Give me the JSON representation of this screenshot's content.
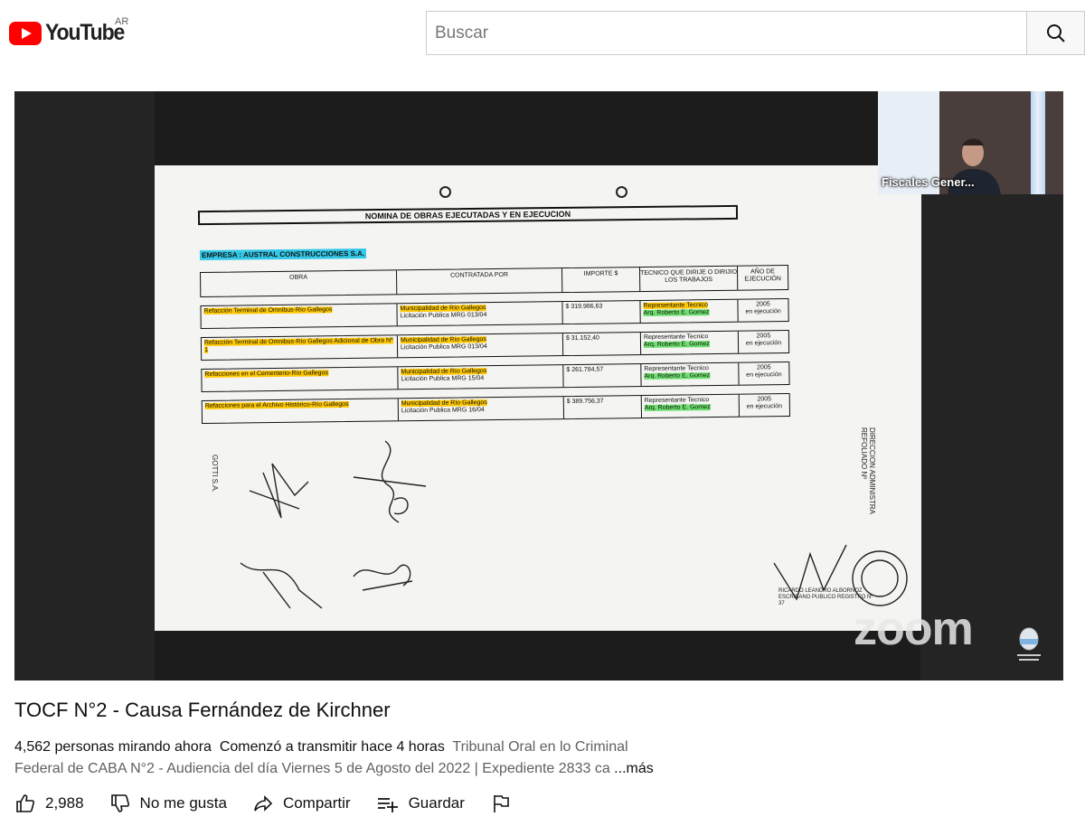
{
  "header": {
    "logo_text": "YouTube",
    "country_code": "AR",
    "search_placeholder": "Buscar"
  },
  "video": {
    "document": {
      "title": "NOMINA DE OBRAS EJECUTADAS Y EN EJECUCION",
      "company": "EMPRESA : AUSTRAL CONSTRUCCIONES S.A.",
      "columns": [
        "OBRA",
        "CONTRATADA POR",
        "IMPORTE $",
        "TECNICO QUE DIRIJE O DIRIJIO LOS TRABAJOS",
        "AÑO DE EJECUCIÓN"
      ],
      "rows": [
        {
          "obra": "Refacción Terminal de Omnibus-Río Gallegos",
          "contratada_1": "Municipalidad de Río Gallegos",
          "contratada_2": "Licitación Publica MRG 013/04",
          "importe": "$ 319.986,63",
          "tecnico_1": "Representante Tecnico",
          "tecnico_2": "Arq. Roberto E. Gomez",
          "anio_1": "2005",
          "anio_2": "en ejecución"
        },
        {
          "obra": "Refacción Terminal de Omnibus-Río Gallegos Adicional de Obra Nº 1",
          "contratada_1": "Municipalidad de Río Gallegos",
          "contratada_2": "Licitación Publica MRG 013/04",
          "importe": "$ 31.152,40",
          "tecnico_1": "Representante Tecnico",
          "tecnico_2": "Arq. Roberto E. Gomez",
          "anio_1": "2005",
          "anio_2": "en ejecución"
        },
        {
          "obra": "Refacciones en el Cementerio-Río Gallegos",
          "contratada_1": "Municipalidad de Río Gallegos",
          "contratada_2": "Licitación Publica MRG 15/04",
          "importe": "$ 261.784,57",
          "tecnico_1": "Representante Tecnico",
          "tecnico_2": "Arq. Roberto E. Gomez",
          "anio_1": "2005",
          "anio_2": "en ejecución"
        },
        {
          "obra": "Refacciones para el Archivo Histórico-Río Gallegos",
          "contratada_1": "Municipalidad de Río Gallegos",
          "contratada_2": "Licitación Publica MRG 16/04",
          "importe": "$ 389.756,37",
          "tecnico_1": "Representante Tecnico",
          "tecnico_2": "Arq. Roberto E. Gomez",
          "anio_1": "2005",
          "anio_2": "en ejecución"
        }
      ],
      "side_stamp": "DIRECCION ADMINISTRA REFOLIADO Nº",
      "notary": "RICARDO LEANDRO ALBORNOZ ESCRIBANO PUBLICO REGISTRO Nº 37"
    },
    "watermark": "zoom",
    "pip_label": "Fiscales Gener..."
  },
  "info": {
    "title": "TOCF N°2 - Causa Fernández de Kirchner",
    "viewers": "4,562 personas mirando ahora",
    "started": "Comenzó a transmitir hace 4 horas",
    "description_1": "Tribunal Oral en lo Criminal",
    "description_2": "Federal de CABA N°2 - Audiencia del día Viernes 5 de Agosto del 2022 | Expediente 2833 ca",
    "more": "...más"
  },
  "actions": {
    "like_count": "2,988",
    "dislike_label": "No me gusta",
    "share_label": "Compartir",
    "save_label": "Guardar"
  },
  "colors": {
    "brand_red": "#ff0000",
    "highlight_yellow": "#ffc800",
    "highlight_green": "#6fe06f",
    "highlight_cyan": "#33c8e8"
  }
}
